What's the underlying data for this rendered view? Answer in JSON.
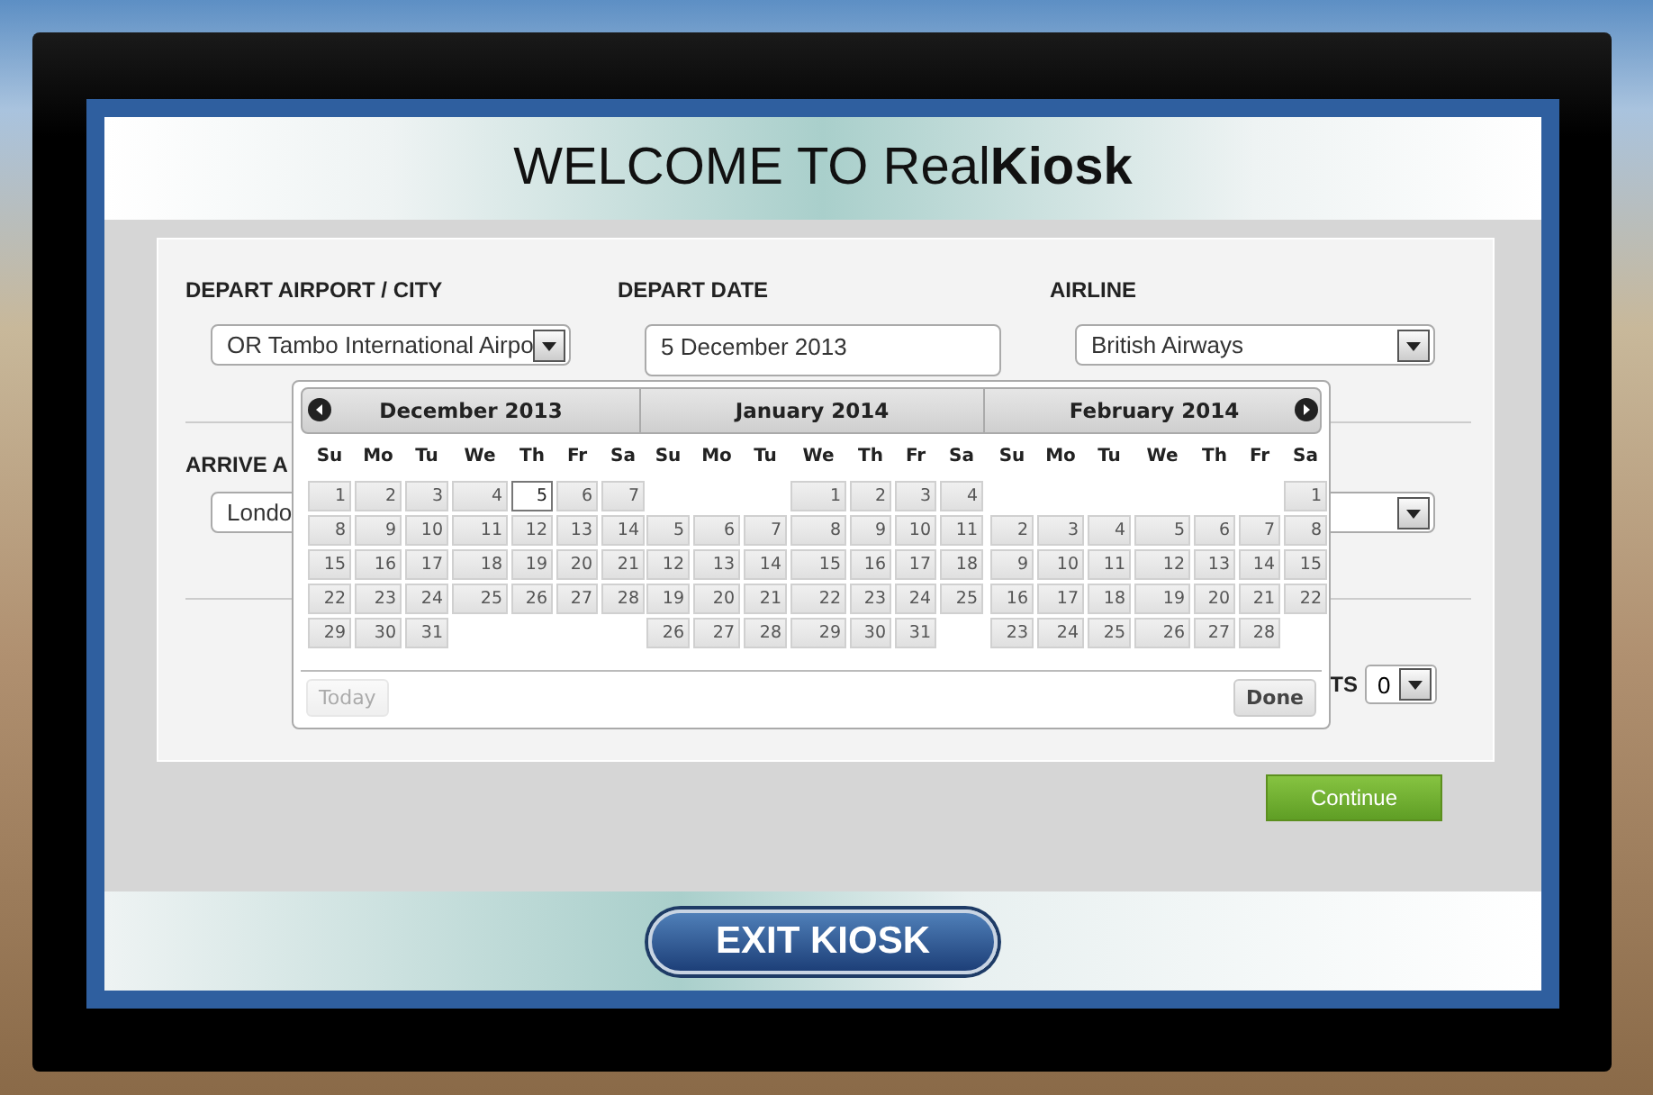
{
  "header": {
    "title": "WELCOME TO Real**Kiosk**"
  },
  "form": {
    "rows": [
      {
        "left": {
          "label": "DEPART AIRPORT / CITY",
          "kind": "select",
          "value": "OR Tambo International Airpo"
        },
        "middle": {
          "label": "DEPART DATE",
          "kind": "input",
          "value": "5 December 2013"
        },
        "right": {
          "label": "AIRLINE",
          "kind": "select",
          "value": "British Airways"
        }
      },
      {
        "left": {
          "label": "ARRIVE A",
          "kind": "select",
          "value": "Londo"
        },
        "right": {
          "kind": "select"
        }
      },
      {
        "right": {
          "label": "TS",
          "kind": "count",
          "value": "0"
        }
      }
    ]
  },
  "calendar": {
    "months": [
      {
        "title": "December 2013",
        "weekdays": [
          "Su",
          "Mo",
          "Tu",
          "We",
          "Th",
          "Fr",
          "Sa"
        ],
        "weeks": [
          {
            "kind": "regular",
            "days": [
              {
                "day": "1",
                "selected": false
              },
              {
                "day": "2",
                "selected": false
              },
              {
                "day": "3",
                "selected": false
              },
              {
                "day": "4",
                "selected": false
              },
              {
                "day": "5",
                "selected": true
              },
              {
                "day": "6",
                "selected": false
              },
              {
                "day": "7",
                "selected": false
              }
            ]
          },
          {
            "kind": "regular",
            "days": [
              {
                "day": "8",
                "selected": false
              },
              {
                "day": "9",
                "selected": false
              },
              {
                "day": "10",
                "selected": false
              },
              {
                "day": "11",
                "selected": false
              },
              {
                "day": "12",
                "selected": false
              },
              {
                "day": "13",
                "selected": false
              },
              {
                "day": "14",
                "selected": false
              }
            ]
          },
          {
            "kind": "regular",
            "days": [
              {
                "day": "15",
                "selected": false
              },
              {
                "day": "16",
                "selected": false
              },
              {
                "day": "17",
                "selected": false
              },
              {
                "day": "18",
                "selected": false
              },
              {
                "day": "19",
                "selected": false
              },
              {
                "day": "20",
                "selected": false
              },
              {
                "day": "21",
                "selected": false
              }
            ]
          },
          {
            "kind": "regular",
            "days": [
              {
                "day": "22",
                "selected": false
              },
              {
                "day": "23",
                "selected": false
              },
              {
                "day": "24",
                "selected": false
              },
              {
                "day": "25",
                "selected": false
              },
              {
                "day": "26",
                "selected": false
              },
              {
                "day": "27",
                "selected": false
              },
              {
                "day": "28",
                "selected": false
              }
            ]
          },
          {
            "kind": "regular",
            "days": [
              {
                "day": "29",
                "selected": false
              },
              {
                "day": "30",
                "selected": false
              },
              {
                "day": "31",
                "selected": false
              }
            ]
          }
        ]
      },
      {
        "title": "January 2014",
        "weekdays": [
          "Su",
          "Mo",
          "Tu",
          "We",
          "Th",
          "Fr",
          "Sa"
        ],
        "weeks": [
          {
            "kind": "leading",
            "days": [
              {
                "day": "1",
                "selected": false
              },
              {
                "day": "2",
                "selected": false
              },
              {
                "day": "3",
                "selected": false
              },
              {
                "day": "4",
                "selected": false
              }
            ]
          },
          {
            "kind": "regular",
            "days": [
              {
                "day": "5",
                "selected": false
              },
              {
                "day": "6",
                "selected": false
              },
              {
                "day": "7",
                "selected": false
              },
              {
                "day": "8",
                "selected": false
              },
              {
                "day": "9",
                "selected": false
              },
              {
                "day": "10",
                "selected": false
              },
              {
                "day": "11",
                "selected": false
              }
            ]
          },
          {
            "kind": "regular",
            "days": [
              {
                "day": "12",
                "selected": false
              },
              {
                "day": "13",
                "selected": false
              },
              {
                "day": "14",
                "selected": false
              },
              {
                "day": "15",
                "selected": false
              },
              {
                "day": "16",
                "selected": false
              },
              {
                "day": "17",
                "selected": false
              },
              {
                "day": "18",
                "selected": false
              }
            ]
          },
          {
            "kind": "regular",
            "days": [
              {
                "day": "19",
                "selected": false
              },
              {
                "day": "20",
                "selected": false
              },
              {
                "day": "21",
                "selected": false
              },
              {
                "day": "22",
                "selected": false
              },
              {
                "day": "23",
                "selected": false
              },
              {
                "day": "24",
                "selected": false
              },
              {
                "day": "25",
                "selected": false
              }
            ]
          },
          {
            "kind": "regular",
            "days": [
              {
                "day": "26",
                "selected": false
              },
              {
                "day": "27",
                "selected": false
              },
              {
                "day": "28",
                "selected": false
              },
              {
                "day": "29",
                "selected": false
              },
              {
                "day": "30",
                "selected": false
              },
              {
                "day": "31",
                "selected": false
              }
            ]
          }
        ]
      },
      {
        "title": "February 2014",
        "weekdays": [
          "Su",
          "Mo",
          "Tu",
          "We",
          "Th",
          "Fr",
          "Sa"
        ],
        "weeks": [
          {
            "kind": "leading",
            "days": [
              {
                "day": "1",
                "selected": false
              }
            ]
          },
          {
            "kind": "regular",
            "days": [
              {
                "day": "2",
                "selected": false
              },
              {
                "day": "3",
                "selected": false
              },
              {
                "day": "4",
                "selected": false
              },
              {
                "day": "5",
                "selected": false
              },
              {
                "day": "6",
                "selected": false
              },
              {
                "day": "7",
                "selected": false
              },
              {
                "day": "8",
                "selected": false
              }
            ]
          },
          {
            "kind": "regular",
            "days": [
              {
                "day": "9",
                "selected": false
              },
              {
                "day": "10",
                "selected": false
              },
              {
                "day": "11",
                "selected": false
              },
              {
                "day": "12",
                "selected": false
              },
              {
                "day": "13",
                "selected": false
              },
              {
                "day": "14",
                "selected": false
              },
              {
                "day": "15",
                "selected": false
              }
            ]
          },
          {
            "kind": "regular",
            "days": [
              {
                "day": "16",
                "selected": false
              },
              {
                "day": "17",
                "selected": false
              },
              {
                "day": "18",
                "selected": false
              },
              {
                "day": "19",
                "selected": false
              },
              {
                "day": "20",
                "selected": false
              },
              {
                "day": "21",
                "selected": false
              },
              {
                "day": "22",
                "selected": false
              }
            ]
          },
          {
            "kind": "regular",
            "days": [
              {
                "day": "23",
                "selected": false
              },
              {
                "day": "24",
                "selected": false
              },
              {
                "day": "25",
                "selected": false
              },
              {
                "day": "26",
                "selected": false
              },
              {
                "day": "27",
                "selected": false
              },
              {
                "day": "28",
                "selected": false
              }
            ]
          }
        ]
      }
    ],
    "today_button": {
      "label": "Today",
      "disabled": true
    },
    "done_button": {
      "label": "Done",
      "disabled": false
    }
  },
  "continue_button": "Continue",
  "exit_button": "EXIT KIOSK"
}
